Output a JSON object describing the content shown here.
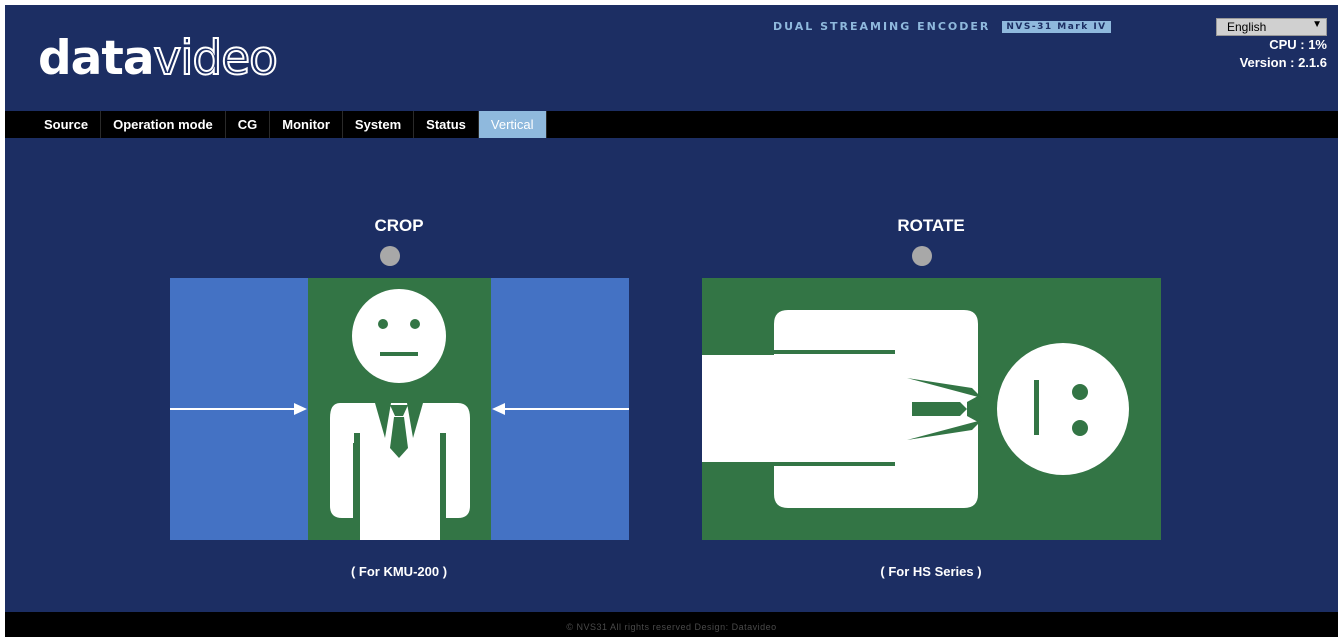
{
  "header": {
    "logo_bold": "data",
    "logo_thin": "video",
    "product_label": "DUAL STREAMING ENCODER",
    "product_model": "NVS-31 Mark IV",
    "language": "English",
    "cpu": "CPU : 1%",
    "version": "Version : 2.1.6"
  },
  "nav": {
    "tabs": [
      {
        "label": "Source"
      },
      {
        "label": "Operation mode"
      },
      {
        "label": "CG"
      },
      {
        "label": "Monitor"
      },
      {
        "label": "System"
      },
      {
        "label": "Status"
      },
      {
        "label": "Vertical"
      }
    ],
    "active": "Vertical"
  },
  "options": [
    {
      "title": "CROP",
      "note": "( For KMU-200 )",
      "selected": false
    },
    {
      "title": "ROTATE",
      "note": "( For HS Series )",
      "selected": false
    }
  ],
  "footer": {
    "text": "© NVS31 All rights reserved Design: Datavideo"
  },
  "colors": {
    "background": "#1c2e63",
    "accent": "#8fb9dd",
    "illustration_green": "#337545",
    "illustration_blue": "#4472c4"
  }
}
